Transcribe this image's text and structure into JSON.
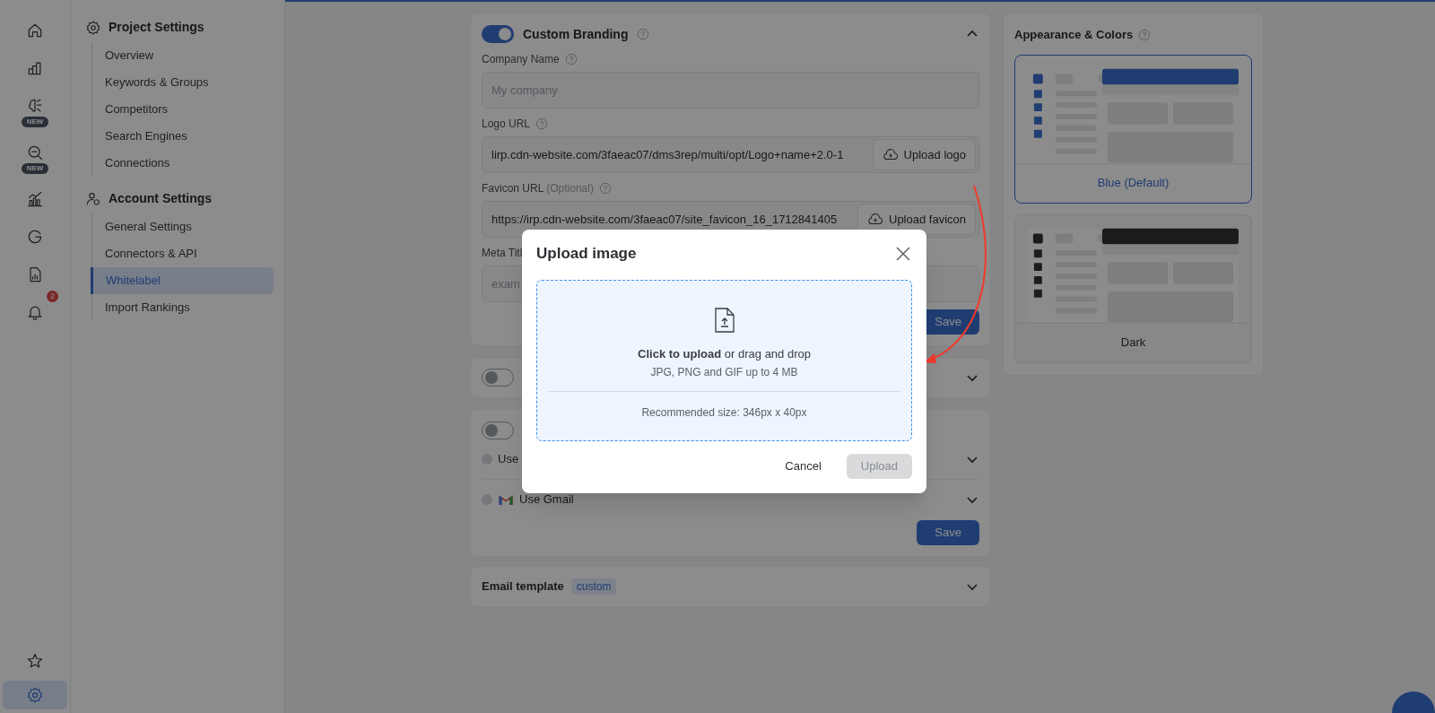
{
  "icon_rail": [
    {
      "kind": "home",
      "selected": false
    },
    {
      "kind": "bars",
      "selected": false
    },
    {
      "kind": "brain",
      "selected": false,
      "badge": "NEW"
    },
    {
      "kind": "search",
      "selected": false,
      "badge": "NEW"
    },
    {
      "kind": "chart",
      "selected": false
    },
    {
      "kind": "google",
      "selected": false
    },
    {
      "kind": "report",
      "selected": false
    },
    {
      "kind": "bell",
      "selected": false,
      "count": "2"
    }
  ],
  "icon_rail_bottom": [
    {
      "kind": "star",
      "selected": false
    },
    {
      "kind": "gear",
      "selected": true
    }
  ],
  "settings_nav": [
    {
      "kind": "gear",
      "title": "Project Settings",
      "items": [
        {
          "label": "Overview",
          "selected": false
        },
        {
          "label": "Keywords & Groups",
          "selected": false
        },
        {
          "label": "Competitors",
          "selected": false
        },
        {
          "label": "Search Engines",
          "selected": false
        },
        {
          "label": "Connections",
          "selected": false
        }
      ]
    },
    {
      "kind": "user",
      "title": "Account Settings",
      "items": [
        {
          "label": "General Settings",
          "selected": false
        },
        {
          "label": "Connectors & API",
          "selected": false
        },
        {
          "label": "Whitelabel",
          "selected": true
        },
        {
          "label": "Import Rankings",
          "selected": false
        }
      ]
    }
  ],
  "branding": {
    "title": "Custom Branding",
    "on": true,
    "expanded": true,
    "fields": [
      {
        "label": "Company Name",
        "placeholder": "My company"
      },
      {
        "label": "Logo URL",
        "value": "lirp.cdn-website.com/3faeac07/dms3rep/multi/opt/Logo+name+2.0-1",
        "button": "Upload logo"
      },
      {
        "label": "Favicon URL",
        "optional": "(Optional)",
        "value": "https://irp.cdn-website.com/3faeac07/site_favicon_16_1712841405",
        "button": "Upload favicon"
      },
      {
        "label": "Meta Titl",
        "placeholder": "exam"
      }
    ],
    "save": "Save"
  },
  "section_2": {
    "on": false
  },
  "section_3": {
    "on": false,
    "options": [
      {
        "label": "Use",
        "kind": "plain",
        "selected": false
      },
      {
        "label": "Use Gmail",
        "kind": "gmail",
        "selected": false
      }
    ],
    "save": "Save"
  },
  "email_template": {
    "title": "Email template",
    "tag": "custom"
  },
  "appearance": {
    "title": "Appearance & Colors",
    "themes": [
      {
        "name": "Blue",
        "note": "(Default)",
        "kind": "blue",
        "selected": true
      },
      {
        "name": "Dark",
        "kind": "dark",
        "selected": false
      }
    ]
  },
  "modal": {
    "title": "Upload image",
    "drop_action": "**Click to upload** or drag and drop",
    "formats": "JPG, PNG and GIF up to 4 MB",
    "recommended": "Recommended size: 346px x 40px",
    "cancel": "Cancel",
    "upload": "Upload",
    "upload_disabled": true
  }
}
